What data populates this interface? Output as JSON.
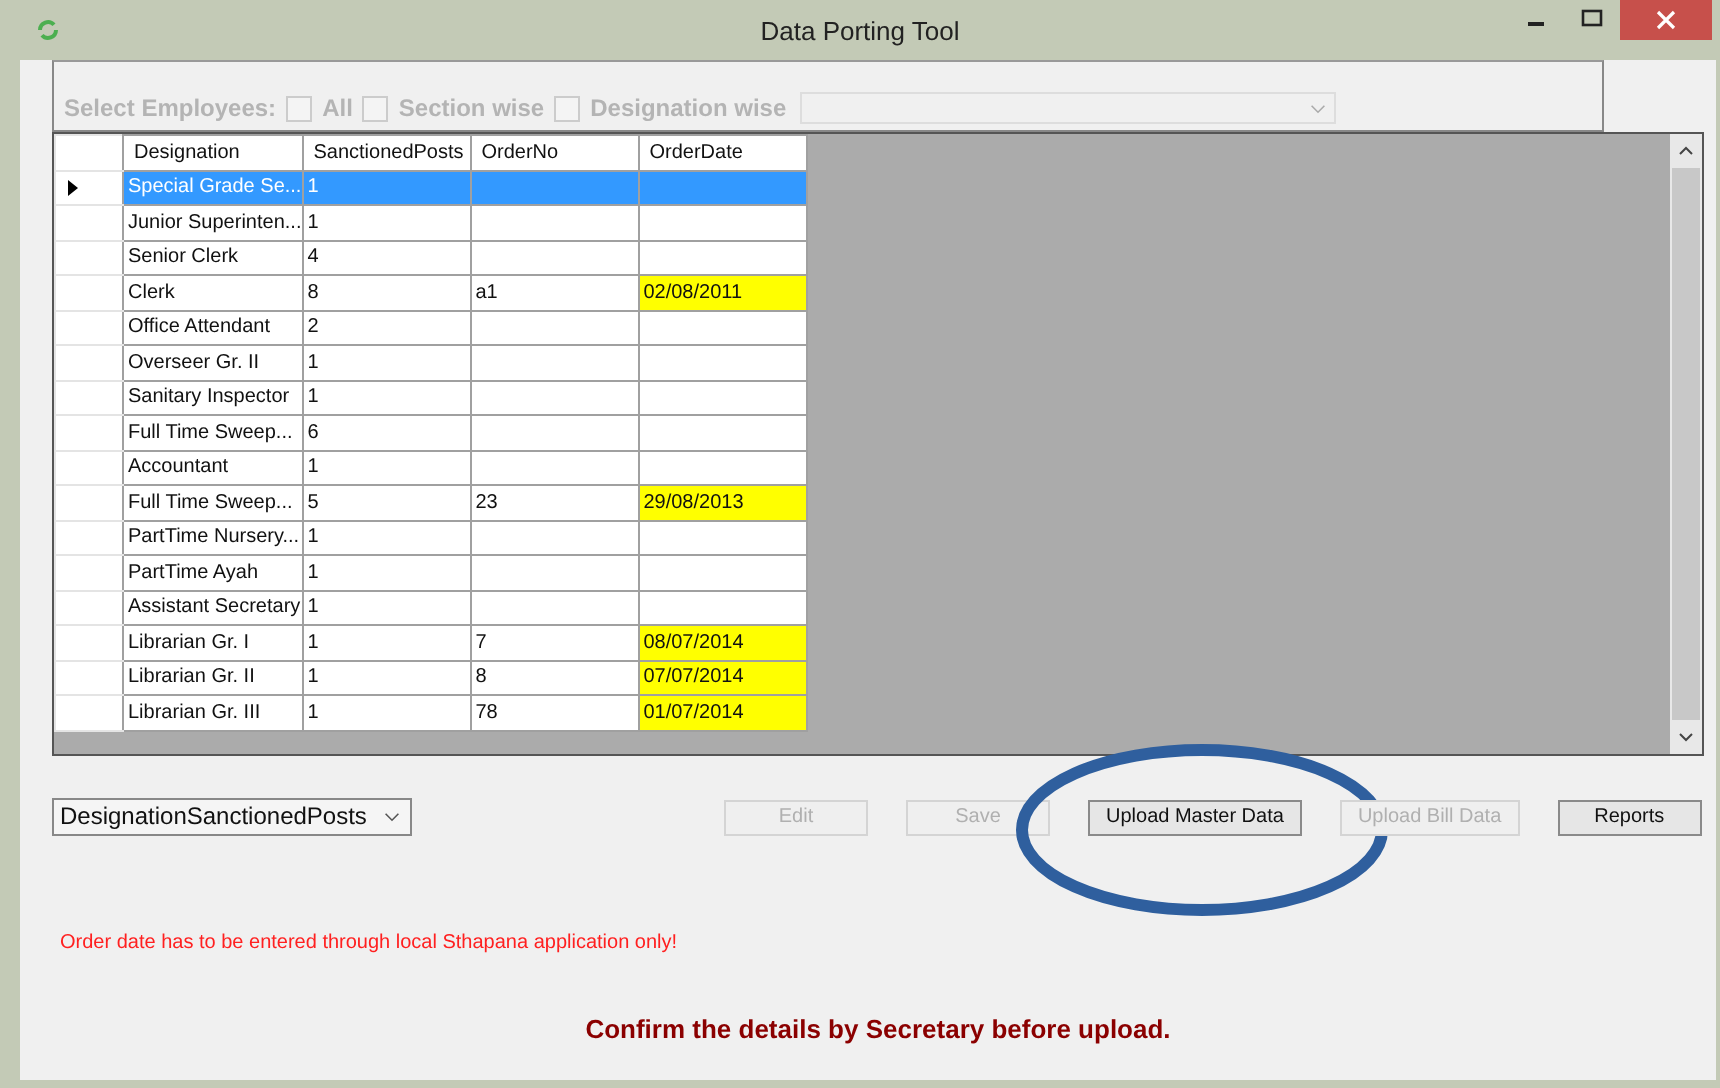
{
  "window": {
    "title": "Data Porting Tool"
  },
  "filter": {
    "label": "Select Employees:",
    "disabled": true,
    "options": [
      {
        "label": "All",
        "checked": false
      },
      {
        "label": "Section wise",
        "checked": false
      },
      {
        "label": "Designation wise",
        "checked": false
      }
    ]
  },
  "table": {
    "columns": [
      "Designation",
      "SanctionedPosts",
      "OrderNo",
      "OrderDate"
    ],
    "rows": [
      {
        "designation": "Special Grade Se...",
        "posts": "1",
        "order_no": "",
        "order_date": "",
        "selected": true,
        "highlighted": false
      },
      {
        "designation": "Junior Superinten...",
        "posts": "1",
        "order_no": "",
        "order_date": "",
        "selected": false,
        "highlighted": false
      },
      {
        "designation": "Senior Clerk",
        "posts": "4",
        "order_no": "",
        "order_date": "",
        "selected": false,
        "highlighted": false
      },
      {
        "designation": "Clerk",
        "posts": "8",
        "order_no": "a1",
        "order_date": "02/08/2011",
        "selected": false,
        "highlighted": true
      },
      {
        "designation": "Office Attendant",
        "posts": "2",
        "order_no": "",
        "order_date": "",
        "selected": false,
        "highlighted": false
      },
      {
        "designation": "Overseer Gr. II",
        "posts": "1",
        "order_no": "",
        "order_date": "",
        "selected": false,
        "highlighted": false
      },
      {
        "designation": "Sanitary Inspector",
        "posts": "1",
        "order_no": "",
        "order_date": "",
        "selected": false,
        "highlighted": false
      },
      {
        "designation": "Full Time Sweep...",
        "posts": "6",
        "order_no": "",
        "order_date": "",
        "selected": false,
        "highlighted": false
      },
      {
        "designation": "Accountant",
        "posts": "1",
        "order_no": "",
        "order_date": "",
        "selected": false,
        "highlighted": false
      },
      {
        "designation": "Full Time Sweep...",
        "posts": "5",
        "order_no": "23",
        "order_date": "29/08/2013",
        "selected": false,
        "highlighted": true
      },
      {
        "designation": "PartTime Nursery...",
        "posts": "1",
        "order_no": "",
        "order_date": "",
        "selected": false,
        "highlighted": false
      },
      {
        "designation": "PartTime Ayah",
        "posts": "1",
        "order_no": "",
        "order_date": "",
        "selected": false,
        "highlighted": false
      },
      {
        "designation": "Assistant Secretary",
        "posts": "1",
        "order_no": "",
        "order_date": "",
        "selected": false,
        "highlighted": false
      },
      {
        "designation": "Librarian Gr. I",
        "posts": "1",
        "order_no": "7",
        "order_date": "08/07/2014",
        "selected": false,
        "highlighted": true
      },
      {
        "designation": "Librarian Gr. II",
        "posts": "1",
        "order_no": "8",
        "order_date": "07/07/2014",
        "selected": false,
        "highlighted": true
      },
      {
        "designation": "Librarian Gr. III",
        "posts": "1",
        "order_no": "78",
        "order_date": "01/07/2014",
        "selected": false,
        "highlighted": true
      }
    ]
  },
  "table_select": {
    "value": "DesignationSanctionedPosts"
  },
  "buttons": [
    {
      "label": "Edit",
      "disabled": true,
      "circled": false
    },
    {
      "label": "Save",
      "disabled": true,
      "circled": false
    },
    {
      "label": "Upload Master Data",
      "disabled": false,
      "circled": true
    },
    {
      "label": "Upload Bill Data",
      "disabled": true,
      "circled": false
    },
    {
      "label": "Reports",
      "disabled": false,
      "circled": false
    }
  ],
  "warning": "Order date has to be entered through local Sthapana application only!",
  "notice": "Confirm the details by Secretary before upload."
}
